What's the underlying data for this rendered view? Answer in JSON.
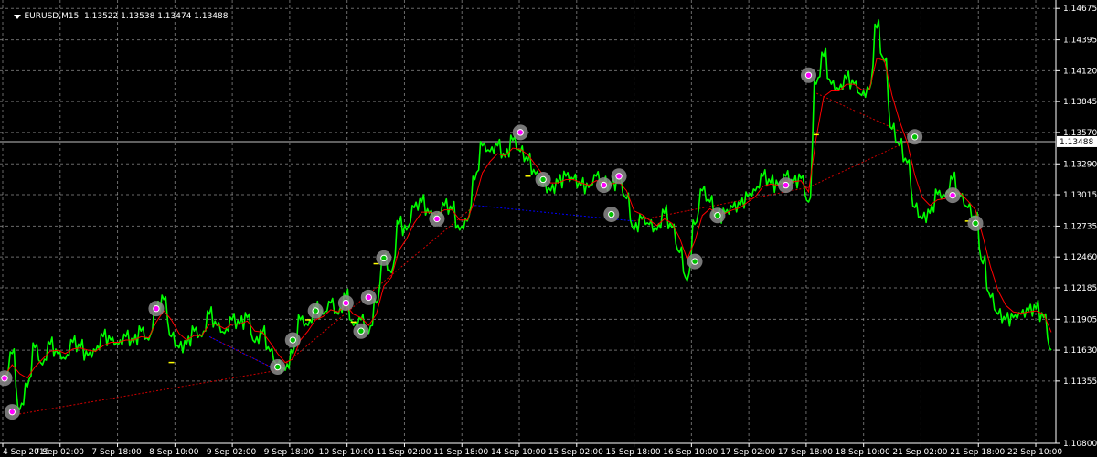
{
  "header": {
    "symbol": "EURUSD,M15",
    "ohlc": "1.13522 1.13538 1.13474 1.13488"
  },
  "current_price_label": "1.13488",
  "colors": {
    "background": "#000000",
    "grid": "#c0c0c0",
    "price_line": "#00ff00",
    "moving_average": "#ff0000",
    "zigzag_up": "#cc0000",
    "zigzag_down": "#0000ff",
    "axis_text": "#ffffff",
    "level_marker": "#ffff00",
    "signal_circle": "#8c8c8c"
  },
  "chart_data": {
    "type": "line",
    "symbol": "EURUSD",
    "timeframe": "M15",
    "grid": true,
    "ylim": [
      1.108,
      1.1475
    ],
    "yticks": [
      1.108,
      1.11355,
      1.1163,
      1.11905,
      1.12185,
      1.1246,
      1.12735,
      1.13015,
      1.1329,
      1.1357,
      1.13845,
      1.1412,
      1.14395,
      1.14675
    ],
    "ytick_labels": [
      "1.10800",
      "1.11355",
      "1.11630",
      "1.11905",
      "1.12185",
      "1.12460",
      "1.12735",
      "1.13015",
      "1.13290",
      "1.13570",
      "1.13845",
      "1.14120",
      "1.14395",
      "1.14675"
    ],
    "xticks": [
      "4 Sep 2015",
      "7 Sep 02:00",
      "7 Sep 18:00",
      "8 Sep 10:00",
      "9 Sep 02:00",
      "9 Sep 18:00",
      "10 Sep 10:00",
      "11 Sep 02:00",
      "11 Sep 18:00",
      "14 Sep 10:00",
      "15 Sep 02:00",
      "15 Sep 18:00",
      "16 Sep 10:00",
      "17 Sep 02:00",
      "17 Sep 18:00",
      "18 Sep 10:00",
      "21 Sep 02:00",
      "21 Sep 18:00",
      "22 Sep 10:00"
    ],
    "current_price": 1.13488,
    "series": [
      {
        "style": "price",
        "values": [
          1.1135,
          1.116,
          1.111,
          1.113,
          1.1165,
          1.115,
          1.1168,
          1.116,
          1.1155,
          1.117,
          1.1165,
          1.1158,
          1.1162,
          1.1175,
          1.1172,
          1.1168,
          1.1175,
          1.117,
          1.118,
          1.1172,
          1.12,
          1.1208,
          1.1175,
          1.1165,
          1.1168,
          1.118,
          1.1175,
          1.1195,
          1.1185,
          1.1178,
          1.119,
          1.1186,
          1.1192,
          1.117,
          1.1178,
          1.1162,
          1.115,
          1.1145,
          1.116,
          1.119,
          1.1185,
          1.12,
          1.1195,
          1.1205,
          1.1195,
          1.121,
          1.1185,
          1.119,
          1.1178,
          1.1205,
          1.1245,
          1.1232,
          1.1275,
          1.127,
          1.129,
          1.1295,
          1.1285,
          1.1282,
          1.1292,
          1.1288,
          1.127,
          1.1278,
          1.1315,
          1.1345,
          1.134,
          1.1345,
          1.1335,
          1.135,
          1.134,
          1.1332,
          1.132,
          1.131,
          1.1305,
          1.1312,
          1.1318,
          1.1315,
          1.131,
          1.1308,
          1.1318,
          1.1312,
          1.131,
          1.1315,
          1.1298,
          1.127,
          1.128,
          1.1275,
          1.127,
          1.1285,
          1.1272,
          1.125,
          1.1225,
          1.1275,
          1.1305,
          1.1295,
          1.1282,
          1.1285,
          1.129,
          1.1292,
          1.13,
          1.1305,
          1.1318,
          1.1312,
          1.131,
          1.1318,
          1.1312,
          1.1316,
          1.1295,
          1.14,
          1.1425,
          1.14,
          1.1395,
          1.1405,
          1.14,
          1.139,
          1.1395,
          1.145,
          1.142,
          1.136,
          1.1345,
          1.133,
          1.129,
          1.128,
          1.1285,
          1.1302,
          1.13,
          1.1315,
          1.13,
          1.129,
          1.128,
          1.124,
          1.121,
          1.1195,
          1.119,
          1.1192,
          1.1195,
          1.1198,
          1.12,
          1.1192,
          1.1163
        ]
      },
      {
        "style": "moving_average",
        "values": [
          1.114,
          1.115,
          1.1142,
          1.1138,
          1.1148,
          1.1155,
          1.1162,
          1.1163,
          1.116,
          1.1164,
          1.1165,
          1.1163,
          1.1162,
          1.1167,
          1.117,
          1.117,
          1.1172,
          1.1172,
          1.1175,
          1.1174,
          1.1188,
          1.1198,
          1.119,
          1.1178,
          1.1172,
          1.1176,
          1.1176,
          1.1186,
          1.1186,
          1.1182,
          1.1186,
          1.1186,
          1.1189,
          1.118,
          1.1179,
          1.117,
          1.116,
          1.1152,
          1.1155,
          1.1172,
          1.118,
          1.119,
          1.1193,
          1.1199,
          1.1197,
          1.1203,
          1.1195,
          1.1192,
          1.1185,
          1.1195,
          1.122,
          1.1228,
          1.1252,
          1.1262,
          1.1276,
          1.1286,
          1.1286,
          1.1284,
          1.1288,
          1.1288,
          1.1279,
          1.1279,
          1.1297,
          1.1321,
          1.1331,
          1.1338,
          1.1336,
          1.1343,
          1.1342,
          1.1337,
          1.1328,
          1.1319,
          1.1312,
          1.1312,
          1.1315,
          1.1315,
          1.1312,
          1.131,
          1.1314,
          1.1313,
          1.1311,
          1.1313,
          1.1305,
          1.1287,
          1.1284,
          1.1279,
          1.1274,
          1.128,
          1.1276,
          1.1263,
          1.1244,
          1.126,
          1.1283,
          1.1289,
          1.1285,
          1.1285,
          1.1288,
          1.129,
          1.1295,
          1.13,
          1.1309,
          1.1311,
          1.131,
          1.1314,
          1.1313,
          1.1314,
          1.1304,
          1.1352,
          1.1389,
          1.1394,
          1.1394,
          1.14,
          1.14,
          1.1395,
          1.1395,
          1.1423,
          1.1421,
          1.139,
          1.1367,
          1.1348,
          1.1319,
          1.1299,
          1.1292,
          1.1297,
          1.1298,
          1.1307,
          1.1303,
          1.1296,
          1.1288,
          1.1264,
          1.1237,
          1.1216,
          1.1203,
          1.1197,
          1.1196,
          1.1197,
          1.1198,
          1.1195,
          1.1179
        ]
      }
    ],
    "zigzag": [
      {
        "x": 1,
        "y": 1.1105,
        "style": "up"
      },
      {
        "x": 36,
        "y": 1.1145,
        "style": "up"
      },
      {
        "x": 27,
        "y": 1.1175,
        "style": "up"
      },
      {
        "x": 36,
        "y": 1.1145,
        "style": "down"
      },
      {
        "x": 62,
        "y": 1.1292,
        "style": "up"
      },
      {
        "x": 83,
        "y": 1.1278,
        "style": "down"
      },
      {
        "x": 106,
        "y": 1.1308,
        "style": "up"
      },
      {
        "x": 120,
        "y": 1.1352,
        "style": "up"
      },
      {
        "x": 107,
        "y": 1.1392,
        "style": "up"
      }
    ],
    "signals": [
      {
        "x": 0,
        "y": 1.1138,
        "type": "buy"
      },
      {
        "x": 1,
        "y": 1.1108,
        "type": "buy"
      },
      {
        "x": 20,
        "y": 1.12,
        "type": "buy"
      },
      {
        "x": 36,
        "y": 1.1148,
        "type": "sell"
      },
      {
        "x": 38,
        "y": 1.1172,
        "type": "sell"
      },
      {
        "x": 41,
        "y": 1.1198,
        "type": "sell"
      },
      {
        "x": 45,
        "y": 1.1205,
        "type": "buy"
      },
      {
        "x": 47,
        "y": 1.118,
        "type": "sell"
      },
      {
        "x": 48,
        "y": 1.121,
        "type": "buy"
      },
      {
        "x": 50,
        "y": 1.1245,
        "type": "sell"
      },
      {
        "x": 57,
        "y": 1.128,
        "type": "buy"
      },
      {
        "x": 68,
        "y": 1.1357,
        "type": "buy"
      },
      {
        "x": 71,
        "y": 1.1315,
        "type": "sell"
      },
      {
        "x": 79,
        "y": 1.131,
        "type": "buy"
      },
      {
        "x": 80,
        "y": 1.1284,
        "type": "sell"
      },
      {
        "x": 81,
        "y": 1.1318,
        "type": "buy"
      },
      {
        "x": 91,
        "y": 1.1242,
        "type": "sell"
      },
      {
        "x": 94,
        "y": 1.1283,
        "type": "sell"
      },
      {
        "x": 103,
        "y": 1.131,
        "type": "buy"
      },
      {
        "x": 106,
        "y": 1.1408,
        "type": "buy"
      },
      {
        "x": 120,
        "y": 1.1353,
        "type": "sell"
      },
      {
        "x": 125,
        "y": 1.1301,
        "type": "buy"
      },
      {
        "x": 128,
        "y": 1.1276,
        "type": "sell"
      }
    ],
    "level_markers": [
      {
        "x": 22,
        "y": 1.1152
      },
      {
        "x": 40,
        "y": 1.119
      },
      {
        "x": 46,
        "y": 1.1188
      },
      {
        "x": 49,
        "y": 1.124
      },
      {
        "x": 69,
        "y": 1.1318
      },
      {
        "x": 107,
        "y": 1.1355
      },
      {
        "x": 127,
        "y": 1.1278
      }
    ]
  }
}
